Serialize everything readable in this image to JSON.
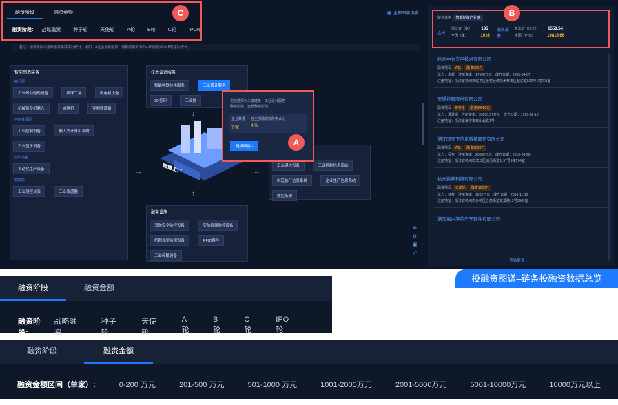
{
  "top": {
    "tabs": [
      "融资阶段",
      "融资金额"
    ],
    "stage_label": "融资阶段:",
    "stages": [
      "战略融资",
      "种子轮",
      "天使轮",
      "A轮",
      "B轮",
      "C轮",
      "IPO轮"
    ],
    "switch_link": "全部图谱切换",
    "note": "备注：融资阶段以最新融资事件进行统计，例如，A企业最新融资，最新的融资为Pre-B轮则以Pre-B轮进行统计。"
  },
  "callouts": {
    "a": "A",
    "b": "B",
    "c": "C"
  },
  "left_panel": {
    "title": "智能制造装备",
    "groups": [
      {
        "name": "执行层",
        "items": [
          "工业传动驱动设备",
          "机床工具",
          "微电机设备",
          "机械臂及机器人",
          "减速机",
          "变频器设备"
        ]
      },
      {
        "name": "控制处理层",
        "items": [
          "工业控制设备",
          "嵌入式计算机系统",
          "工业显示设备"
        ]
      },
      {
        "name": "感知设备",
        "items": [
          "自动化生产设备"
        ]
      },
      {
        "name": "感知层",
        "items": [
          "工业测控仪表",
          "工业传感器"
        ]
      }
    ]
  },
  "tech_panel": {
    "title": "技术设计服务",
    "items": [
      "智能物联技术服务",
      "工业设计服务",
      "3D打印",
      "工业数"
    ]
  },
  "popup": {
    "line1": "当前选择为三级链条：工业设计服务",
    "line2": "融资阶段：全部融资阶段",
    "col1_label": "企业数量",
    "col2_label": "在全部融资阶段中占比",
    "col1_value": "7 家",
    "col2_value": "4 %",
    "button": "链点画像 ›"
  },
  "center_label": "智慧工厂",
  "right_group": {
    "items": [
      "工业通信设备",
      "工业控制信息系统",
      "制造执行信息系统",
      "企业生产信息系统",
      "数控系统"
    ]
  },
  "bottom_panel": {
    "title": "配套设施",
    "items": [
      "消防安全监控设备",
      "安防视频监控设备",
      "机器视觉监测设备",
      "RFID器件",
      "工业传输设备"
    ]
  },
  "stats": {
    "selected_label": "链点选中:",
    "selected_value": "智能制造产业链",
    "enterprise_title": "企业",
    "enterprise_rows": [
      {
        "label": "浙江省（家）",
        "value": "185"
      },
      {
        "label": "全国（家）",
        "value": "1916"
      }
    ],
    "finance_title": "融资规模",
    "finance_rows": [
      {
        "label": "浙江省（亿元）",
        "value": "1558.54"
      },
      {
        "label": "全国（亿元）",
        "value": "19815.66"
      }
    ]
  },
  "companies": [
    {
      "name": "杭州中为光电技术有限公司",
      "stage": "A轮",
      "amount": "融资800万",
      "legal": "法人：朱晨",
      "capital": "注册资本：17500万元",
      "date": "成立日期：2005-04-07",
      "addr": "注册地址：浙江省杭州市临平区余杭经济技术开发区超达路500号1幢201室"
    },
    {
      "name": "天通控股股份有限公司",
      "stage": "IPO轮",
      "amount": "融资36000万",
      "legal": "法人：潘建清",
      "capital": "注册资本：99656.57万元",
      "date": "成立日期：1999-02-10",
      "addr": "注册地址：浙江省海宁市双山北路1号"
    },
    {
      "name": "浙江国天下信息科技股份有限公司",
      "stage": "A轮",
      "amount": "融资2000万",
      "legal": "法人：吴东",
      "capital": "注册资本：20000万元",
      "date": "成立日期：2015-04-20",
      "addr": "注册地址：浙江省杭州市滨江区浦沿街道1197号1幢194室"
    },
    {
      "name": "杭州数神科技有限公司",
      "stage": "天使轮",
      "amount": "融资1000万",
      "legal": "法人：黄权",
      "capital": "注册资本：1282万元",
      "date": "成立日期：2016-11-10",
      "addr": "注册地址：浙江省杭州市余杭区仓前街道龙潭路13号1609室"
    },
    {
      "name": "浙江嘉兴津荣汽车部件有限公司"
    }
  ],
  "view_more": "查看更多 ›",
  "caption": "投融资图谱–链条投融资数据总览",
  "crop1": {
    "tabs": [
      "融资阶段",
      "融资金额"
    ],
    "label": "融资阶段:",
    "stages": [
      "战略融资",
      "种子轮",
      "天使轮",
      "A轮",
      "B轮",
      "C轮",
      "IPO轮"
    ]
  },
  "crop2": {
    "tabs": [
      "融资阶段",
      "融资金额"
    ],
    "label": "融资金额区间（单家）:",
    "ranges": [
      "0-200 万元",
      "201-500 万元",
      "501-1000 万元",
      "1001-2000万元",
      "2001-5000万元",
      "5001-10000万元",
      "10000万元以上"
    ]
  },
  "colors": {
    "accent": "#1e7bff",
    "callout": "#f05a5a",
    "bg": "#0d1627",
    "highlight_value": "#ffc13a"
  }
}
